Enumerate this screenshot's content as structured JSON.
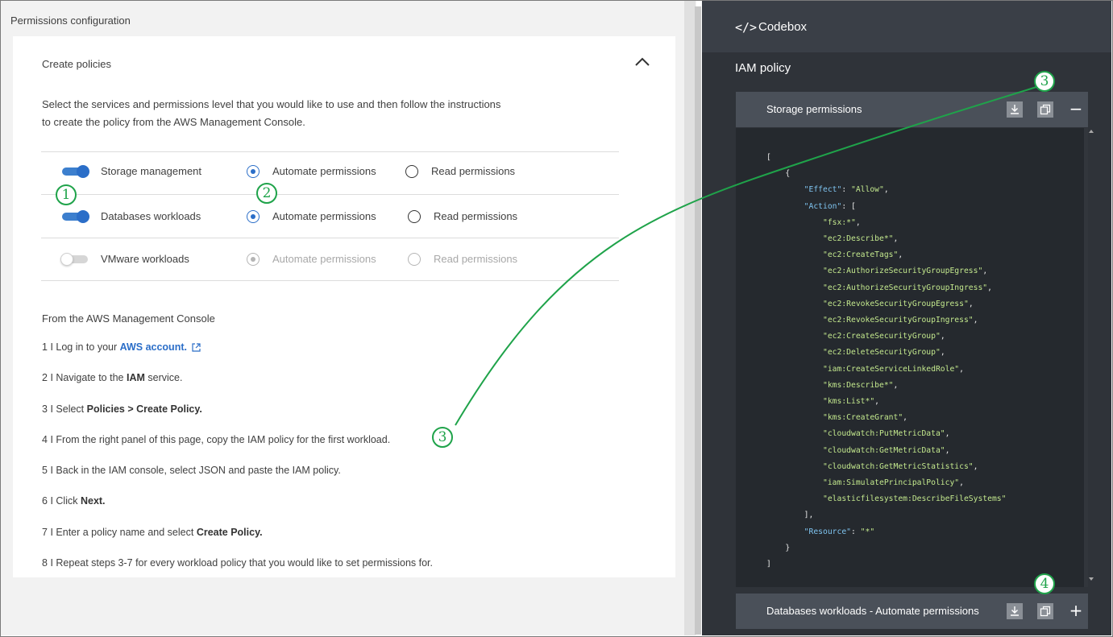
{
  "left": {
    "title": "Permissions configuration",
    "card_title": "Create policies",
    "intro_line1": "Select the services and permissions level that you would like to use and then follow the instructions",
    "intro_line2": "to create the policy from the AWS Management Console.",
    "rows": [
      {
        "label": "Storage management",
        "toggle": "on",
        "option1": "Automate permissions",
        "option2": "Read permissions",
        "selected": "option1",
        "disabled": false
      },
      {
        "label": "Databases workloads",
        "toggle": "on",
        "option1": "Automate permissions",
        "option2": "Read permissions",
        "selected": "option1",
        "disabled": false
      },
      {
        "label": "VMware workloads",
        "toggle": "off",
        "option1": "Automate permissions",
        "option2": "Read permissions",
        "selected": "option1",
        "disabled": true
      }
    ],
    "console_heading": "From the AWS Management Console",
    "steps": [
      {
        "num": "1",
        "pre": "Log in to your ",
        "link": "AWS account."
      },
      {
        "num": "2",
        "pre": "Navigate to the ",
        "bold": "IAM",
        "post": " service."
      },
      {
        "num": "3",
        "pre": "Select ",
        "bold": "Policies > Create Policy."
      },
      {
        "num": "4",
        "pre": "From the right panel of this page, copy the IAM policy for the first workload."
      },
      {
        "num": "5",
        "pre": "Back in the IAM console, select JSON and paste the IAM policy."
      },
      {
        "num": "6",
        "pre": "Click ",
        "bold": "Next."
      },
      {
        "num": "7",
        "pre": "Enter a policy name and select ",
        "bold": "Create Policy."
      },
      {
        "num": "8",
        "pre": "Repeat steps 3-7 for every workload policy that you would like to set permissions for."
      }
    ],
    "step_separator": "I"
  },
  "right": {
    "codebox_icon": "</>",
    "codebox_title": "Codebox",
    "iam_title": "IAM policy",
    "section1_title": "Storage permissions",
    "section1_toggle": "−",
    "section2_title": "Databases workloads - Automate permissions",
    "section2_toggle": "+",
    "code": {
      "open_bracket": "[",
      "open_brace": "{",
      "effect_key": "\"Effect\"",
      "effect_value": "\"Allow\"",
      "action_key": "\"Action\"",
      "actions": [
        "\"fsx:*\"",
        "\"ec2:Describe*\"",
        "\"ec2:CreateTags\"",
        "\"ec2:AuthorizeSecurityGroupEgress\"",
        "\"ec2:AuthorizeSecurityGroupIngress\"",
        "\"ec2:RevokeSecurityGroupEgress\"",
        "\"ec2:RevokeSecurityGroupIngress\"",
        "\"ec2:CreateSecurityGroup\"",
        "\"ec2:DeleteSecurityGroup\"",
        "\"iam:CreateServiceLinkedRole\"",
        "\"kms:Describe*\"",
        "\"kms:List*\"",
        "\"kms:CreateGrant\"",
        "\"cloudwatch:PutMetricData\"",
        "\"cloudwatch:GetMetricData\"",
        "\"cloudwatch:GetMetricStatistics\"",
        "\"iam:SimulatePrincipalPolicy\"",
        "\"elasticfilesystem:DescribeFileSystems\""
      ],
      "resource_key": "\"Resource\"",
      "resource_value": "\"*\"",
      "close_brace": "}",
      "close_bracket": "]"
    }
  },
  "callouts": [
    "1",
    "2",
    "3",
    "3",
    "4"
  ],
  "colors": {
    "accent": "#2b6ec8",
    "callout": "#1fa34a",
    "codebox_bg": "#2f3339",
    "code_key": "#7fc4f0",
    "code_string": "#c3e88d"
  }
}
